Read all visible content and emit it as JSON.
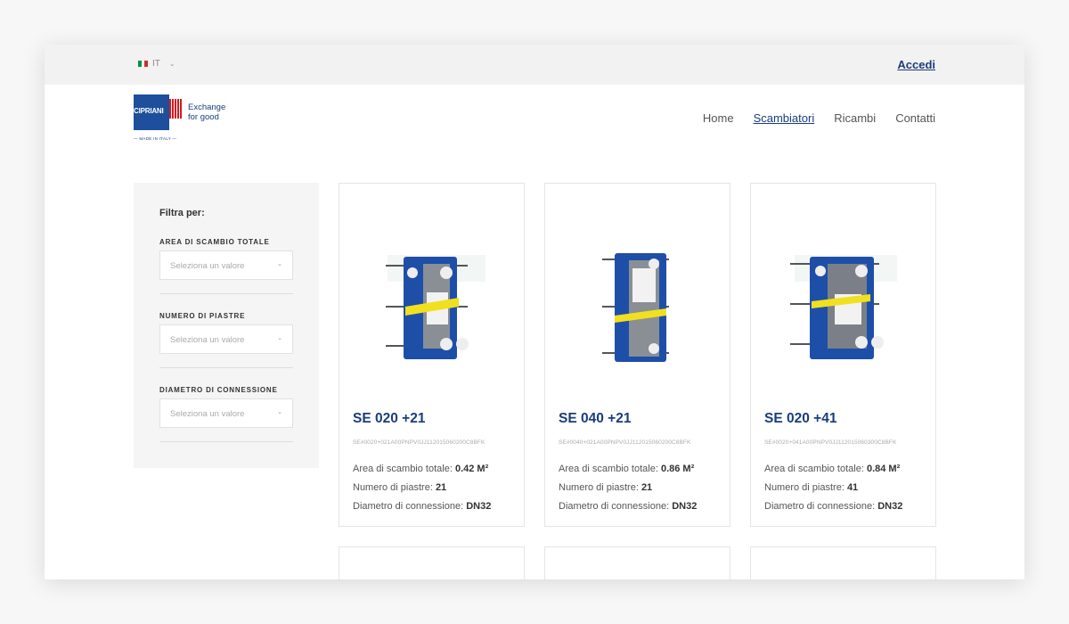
{
  "topbar": {
    "language": "IT",
    "login_label": "Accedi",
    "flag_colors": [
      "#009246",
      "#ffffff",
      "#ce2b37"
    ]
  },
  "brand": {
    "name": "CIPRIANI",
    "slogan_line1": "Exchange",
    "slogan_line2": "for good",
    "made_in": "— MADE IN ITALY —",
    "color": "#1a3d7c"
  },
  "nav": {
    "items": [
      "Home",
      "Scambiatori",
      "Ricambi",
      "Contatti"
    ],
    "active": "Scambiatori"
  },
  "filters": {
    "title": "Filtra per:",
    "groups": [
      {
        "label": "AREA DI SCAMBIO TOTALE",
        "placeholder": "Seleziona un valore"
      },
      {
        "label": "NUMERO DI PIASTRE",
        "placeholder": "Seleziona un valore"
      },
      {
        "label": "DIAMETRO DI CONNESSIONE",
        "placeholder": "Seleziona un valore"
      }
    ]
  },
  "products": [
    {
      "title": "SE 020 +21",
      "code": "SE#0020+021A00PNPV0JJ112015060200C8BFK",
      "area_label": "Area di scambio totale:",
      "area_value": "0.42 M²",
      "plates_label": "Numero di piastre:",
      "plates_value": "21",
      "diameter_label": "Diametro di connessione:",
      "diameter_value": "DN32"
    },
    {
      "title": "SE 040 +21",
      "code": "SE#0040+021A00PNPV0JJ112015060200C8BFK",
      "area_label": "Area di scambio totale:",
      "area_value": "0.86 M²",
      "plates_label": "Numero di piastre:",
      "plates_value": "21",
      "diameter_label": "Diametro di connessione:",
      "diameter_value": "DN32"
    },
    {
      "title": "SE 020 +41",
      "code": "SE#0020+041A00PNPV0JJ112015060300C8BFK",
      "area_label": "Area di scambio totale:",
      "area_value": "0.84 M²",
      "plates_label": "Numero di piastre:",
      "plates_value": "41",
      "diameter_label": "Diametro di connessione:",
      "diameter_value": "DN32"
    }
  ]
}
